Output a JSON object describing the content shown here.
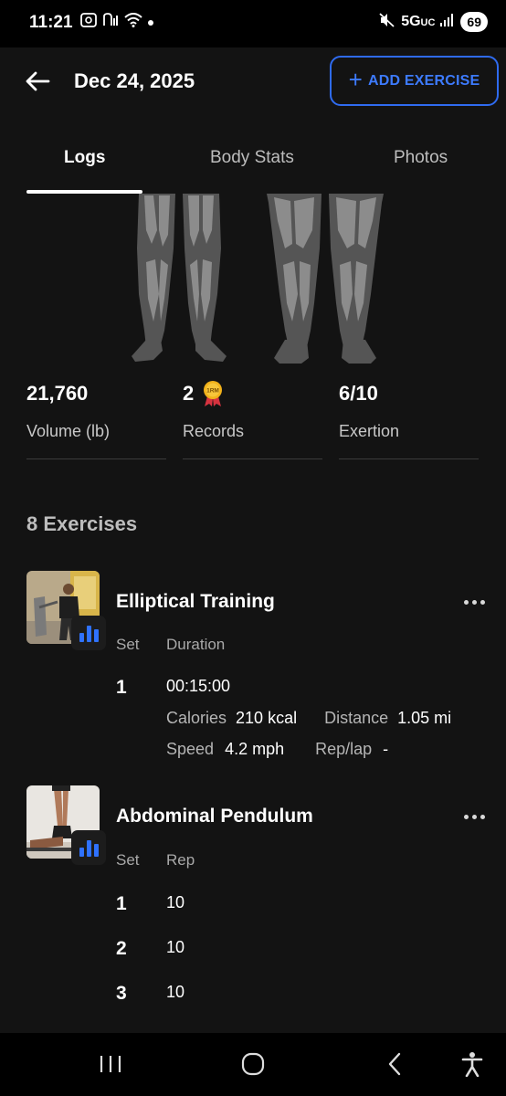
{
  "status_bar": {
    "time": "11:21",
    "network": "5G",
    "network_sub": "UC",
    "battery": "69"
  },
  "header": {
    "date": "Dec 24, 2025",
    "add_button_label": "ADD EXERCISE",
    "accent_color": "#2f6bf0"
  },
  "tabs": [
    {
      "label": "Logs",
      "active": true
    },
    {
      "label": "Body Stats",
      "active": false
    },
    {
      "label": "Photos",
      "active": false
    }
  ],
  "stats": {
    "volume": {
      "value": "21,760",
      "label": "Volume (lb)"
    },
    "records": {
      "value": "2",
      "label": "Records",
      "medal_text": "1RM"
    },
    "exertion": {
      "value": "6/10",
      "label": "Exertion"
    }
  },
  "exercise_count": "8 Exercises",
  "exercises": [
    {
      "name": "Elliptical Training",
      "columns": [
        "Set",
        "Duration"
      ],
      "sets": [
        {
          "set": "1",
          "duration": "00:15:00",
          "calories_label": "Calories",
          "calories": "210 kcal",
          "distance_label": "Distance",
          "distance": "1.05 mi",
          "speed_label": "Speed",
          "speed": "4.2 mph",
          "replap_label": "Rep/lap",
          "replap": "-"
        }
      ]
    },
    {
      "name": "Abdominal Pendulum",
      "columns": [
        "Set",
        "Rep"
      ],
      "sets": [
        {
          "set": "1",
          "rep": "10"
        },
        {
          "set": "2",
          "rep": "10"
        },
        {
          "set": "3",
          "rep": "10"
        }
      ]
    }
  ],
  "nav": {
    "icons": [
      "recent-apps-icon",
      "home-icon",
      "back-icon",
      "accessibility-icon"
    ]
  }
}
